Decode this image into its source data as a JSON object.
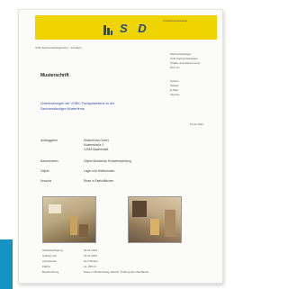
{
  "colors": {
    "header": "#f0d400",
    "brand_text": "#1f4a8e",
    "accent": "#1592c4"
  },
  "header": {
    "logo_text": "S D",
    "logo_icon": "logo-mark-icon",
    "tag": "Prüfsachverständige"
  },
  "sender_line": "SVD Sachverständigenbüro · Postfach",
  "address": [
    "Sachverständiger",
    "SVD Sachverständigen",
    "Straße und Hausnummer",
    "PLZ Ort"
  ],
  "contact": [
    "Telefon",
    "Telefax",
    "E-Mail",
    "Internet"
  ],
  "doc_title": "Musterschrift",
  "subject": "Untersuchungen der VOB/C Fachgutachtens zu der Sachverständigen Musterfirma",
  "date": "01.01.2012",
  "facts": [
    {
      "label": "Auftraggeber",
      "value": [
        "Musterfirma GmbH",
        "Musterstraße 1",
        "12345 Musterstadt"
      ]
    },
    {
      "label": "Bauvorhaben",
      "value": [
        "Objekt Musterbau Schadensprüfung"
      ]
    },
    {
      "label": "Objekt",
      "value": [
        "Lager und Hallenboden"
      ]
    },
    {
      "label": "Ursache",
      "value": [
        "Risse in Estrichflächen"
      ]
    }
  ],
  "details": [
    {
      "label": "Ortsbesichtigung",
      "value": "01.01.2012"
    },
    {
      "label": "Auftrag vom",
      "value": "01.01.2012"
    },
    {
      "label": "Anwesende",
      "value": "Herr Muster"
    },
    {
      "label": "Fläche",
      "value": "ca. 250 m²"
    },
    {
      "label": "Beschreibung",
      "value": "Risse im Bodenbelag, Estrich, Prüfung der Oberfläche"
    }
  ]
}
